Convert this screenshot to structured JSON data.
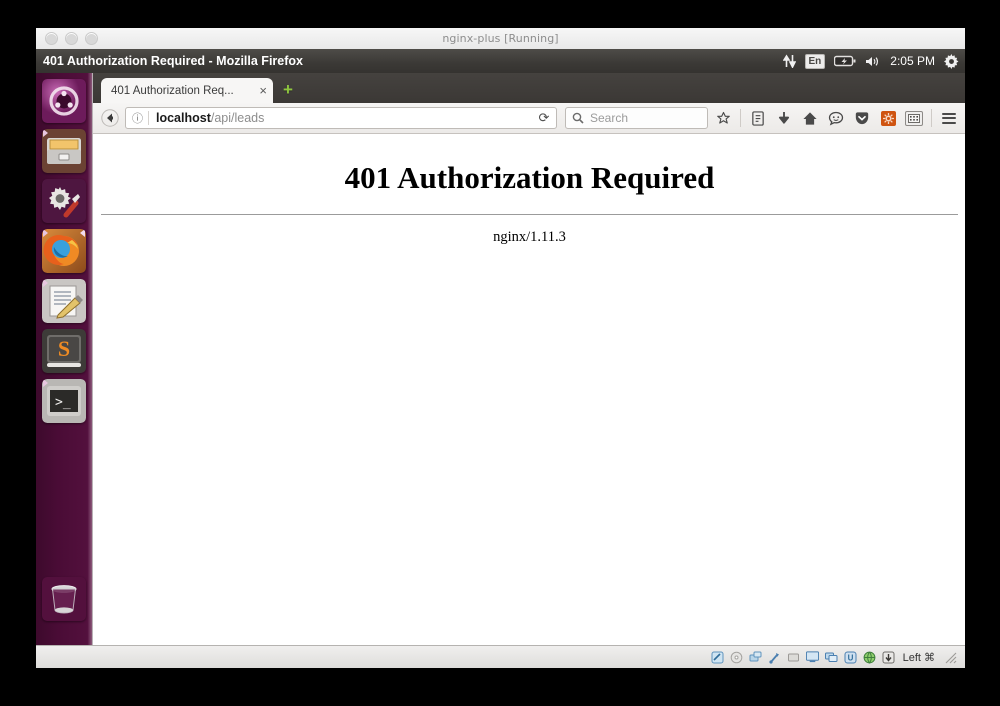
{
  "host_window": {
    "title": "nginx-plus [Running]",
    "controls": [
      "close",
      "minimize",
      "zoom"
    ]
  },
  "guest": {
    "panel": {
      "window_title": "401 Authorization Required - Mozilla Firefox",
      "tray": {
        "network_icon": "network-updown-icon",
        "keyboard_layout": "En",
        "battery_icon": "battery-icon",
        "volume_icon": "volume-icon",
        "clock": "2:05 PM",
        "settings_icon": "gear-icon"
      }
    },
    "launcher": {
      "items": [
        {
          "name": "dash",
          "label": "Ubuntu Dash",
          "running": false
        },
        {
          "name": "files",
          "label": "Files",
          "running": true
        },
        {
          "name": "system-settings",
          "label": "System Settings",
          "running": false
        },
        {
          "name": "firefox",
          "label": "Firefox",
          "running": true,
          "active": true
        },
        {
          "name": "text-editor",
          "label": "Text Editor",
          "running": true
        },
        {
          "name": "sublime-text",
          "label": "Sublime Text",
          "running": false
        },
        {
          "name": "terminal",
          "label": "Terminal",
          "running": true
        }
      ],
      "trash": {
        "name": "trash",
        "label": "Trash"
      }
    },
    "browser": {
      "tab": {
        "label": "401 Authorization Req...",
        "close_label": "×"
      },
      "new_tab_label": "+",
      "toolbar": {
        "back_icon": "back-arrow-icon",
        "identity_icon": "page-info-icon",
        "url_host": "localhost",
        "url_path": "/api/leads",
        "reload_label": "⟳",
        "search_placeholder": "Search",
        "search_icon": "search-icon",
        "buttons": [
          {
            "name": "bookmark-star-icon",
            "glyph": "☆"
          },
          {
            "name": "reading-list-icon",
            "glyph": "☰"
          },
          {
            "name": "download-icon",
            "glyph": "⬇"
          },
          {
            "name": "home-icon",
            "glyph": "⌂"
          },
          {
            "name": "hello-chat-icon",
            "glyph": "☺"
          },
          {
            "name": "pocket-icon",
            "glyph": "▼"
          },
          {
            "name": "addon-orange-icon",
            "glyph": "✶"
          },
          {
            "name": "addon-gray-icon",
            "glyph": "☷"
          },
          {
            "name": "menu-hamburger-icon",
            "glyph": ""
          }
        ]
      },
      "page": {
        "heading": "401 Authorization Required",
        "server_signature": "nginx/1.11.3"
      }
    }
  },
  "vbox_status": {
    "icons": [
      "hard-disk-icon",
      "optical-disk-icon",
      "network-icon",
      "usb-icon",
      "shared-folder-icon",
      "display-icon",
      "remote-desktop-icon",
      "vm-icon",
      "globe-icon",
      "host-key-icon"
    ],
    "host_key": "Left ⌘"
  },
  "colors": {
    "launcher_purple": "#4a0c36",
    "panel_dark": "#3b3936",
    "tab_bar": "#3f3c39",
    "accent_green": "#8ec63f",
    "addon_orange": "#cf5411"
  }
}
